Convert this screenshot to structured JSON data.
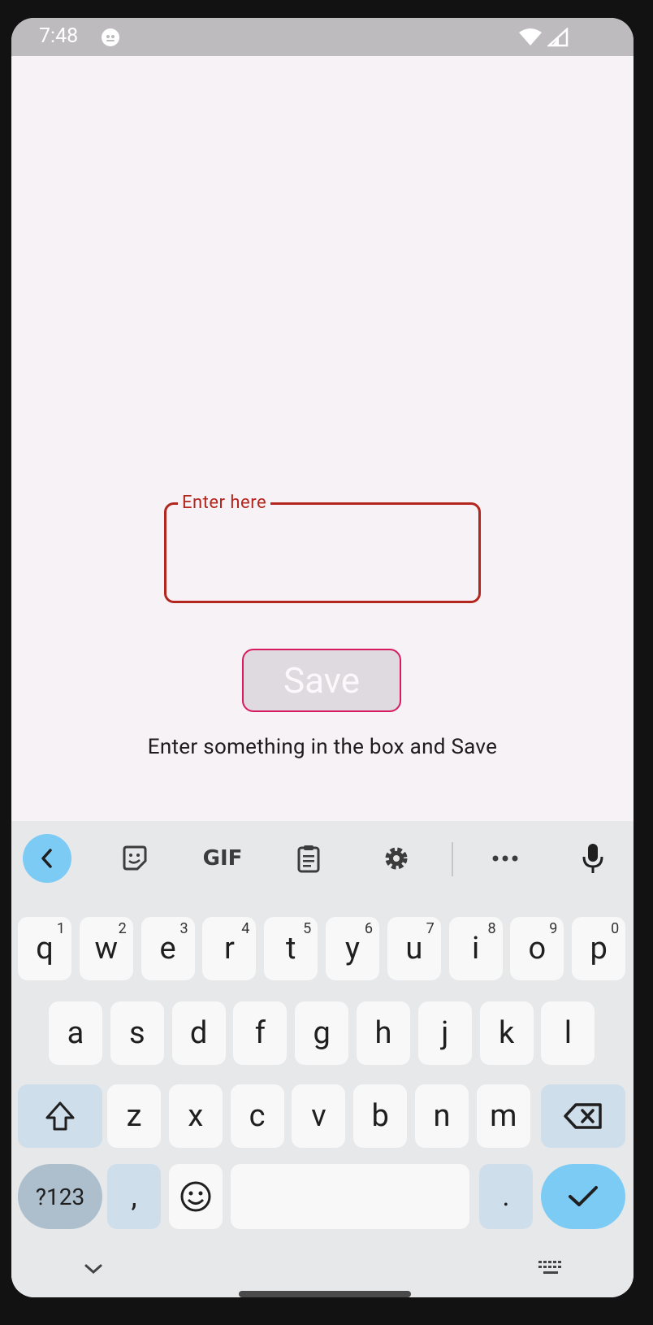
{
  "status": {
    "time": "7:48"
  },
  "form": {
    "field_label": "Enter here",
    "field_value": "",
    "save_label": "Save",
    "hint": "Enter something in the box and Save"
  },
  "keyboard": {
    "toolbar": [
      "back-icon",
      "sticker-icon",
      "gif-icon",
      "clipboard-icon",
      "gear-icon",
      "more-icon",
      "mic-icon"
    ],
    "gif_label": "GIF",
    "row1": [
      {
        "k": "q",
        "n": "1"
      },
      {
        "k": "w",
        "n": "2"
      },
      {
        "k": "e",
        "n": "3"
      },
      {
        "k": "r",
        "n": "4"
      },
      {
        "k": "t",
        "n": "5"
      },
      {
        "k": "y",
        "n": "6"
      },
      {
        "k": "u",
        "n": "7"
      },
      {
        "k": "i",
        "n": "8"
      },
      {
        "k": "o",
        "n": "9"
      },
      {
        "k": "p",
        "n": "0"
      }
    ],
    "row2": [
      "a",
      "s",
      "d",
      "f",
      "g",
      "h",
      "j",
      "k",
      "l"
    ],
    "row3": [
      "z",
      "x",
      "c",
      "v",
      "b",
      "n",
      "m"
    ],
    "sym_label": "?123",
    "comma": ",",
    "period": "."
  },
  "colors": {
    "error": "#b3261e",
    "accent": "#7ccbf5",
    "save_border": "#d81b60"
  }
}
